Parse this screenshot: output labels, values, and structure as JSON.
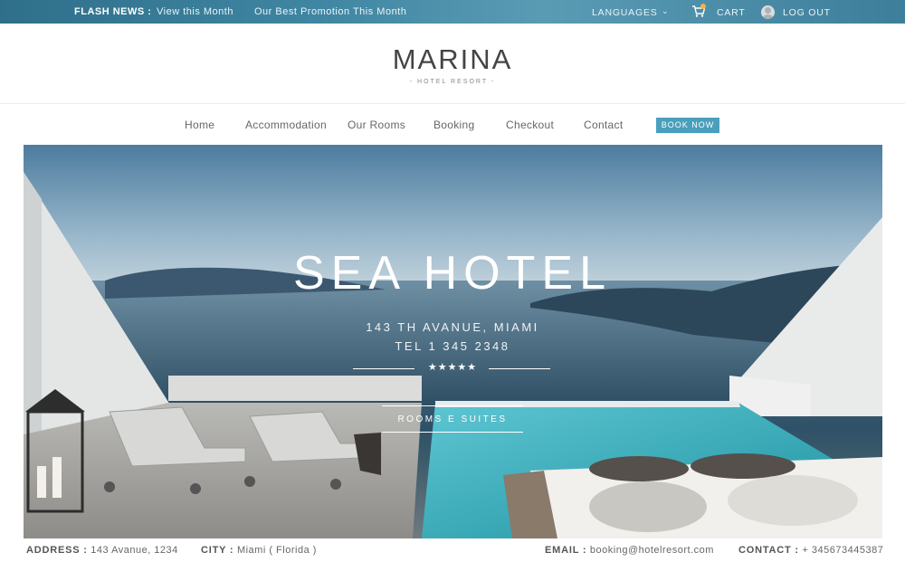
{
  "topbar": {
    "flash_label": "FLASH NEWS :",
    "link_month": "View this Month",
    "link_promo": "Our Best Promotion This Month",
    "languages": "LANGUAGES",
    "cart": "CART",
    "logout": "LOG OUT"
  },
  "brand": {
    "name": "MARINA",
    "tagline": "- HOTEL RESORT -"
  },
  "nav": {
    "items": [
      "Home",
      "Accommodation",
      "Our Rooms",
      "Booking",
      "Checkout",
      "Contact"
    ],
    "book_now": "BOOK NOW"
  },
  "hero": {
    "title": "SEA HOTEL",
    "address": "143 TH AVANUE, MIAMI",
    "tel": "TEL 1 345 2348",
    "stars": "★★★★★",
    "button": "ROOMS E SUITES"
  },
  "footer": {
    "address_label": "ADDRESS :",
    "address_value": "143 Avanue, 1234",
    "city_label": "CITY :",
    "city_value": "Miami ( Florida )",
    "email_label": "EMAIL :",
    "email_value": "booking@hotelresort.com",
    "contact_label": "CONTACT :",
    "contact_value": "+ 345673445387"
  },
  "colors": {
    "accent": "#4a9fbd",
    "topbar": "#3f86a2",
    "star_badge": "#f3b43f"
  }
}
